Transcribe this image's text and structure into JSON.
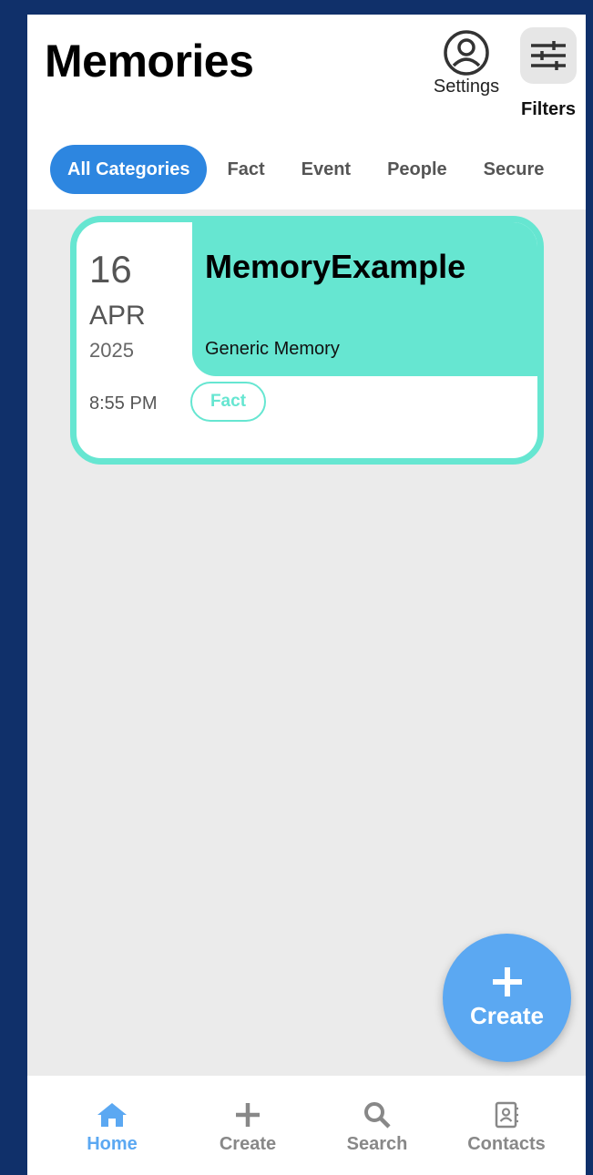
{
  "header": {
    "title": "Memories",
    "settings_label": "Settings",
    "filters_label": "Filters"
  },
  "tabs": [
    {
      "label": "All Categories",
      "active": true
    },
    {
      "label": "Fact",
      "active": false
    },
    {
      "label": "Event",
      "active": false
    },
    {
      "label": "People",
      "active": false
    },
    {
      "label": "Secure",
      "active": false
    }
  ],
  "memories": [
    {
      "title": "MemoryExample",
      "category_text": "Generic Memory",
      "day": "16",
      "month": "APR",
      "year": "2025",
      "time": "8:55 PM",
      "tag": "Fact"
    }
  ],
  "fab": {
    "label": "Create",
    "icon": "plus-icon"
  },
  "bottom_nav": [
    {
      "label": "Home",
      "icon": "home-icon",
      "active": true
    },
    {
      "label": "Create",
      "icon": "plus-icon",
      "active": false
    },
    {
      "label": "Search",
      "icon": "search-icon",
      "active": false
    },
    {
      "label": "Contacts",
      "icon": "contacts-icon",
      "active": false
    }
  ],
  "colors": {
    "background": "#10306a",
    "accent": "#2d86e0",
    "card_border": "#66e6d1",
    "fab": "#5ba8f2"
  }
}
